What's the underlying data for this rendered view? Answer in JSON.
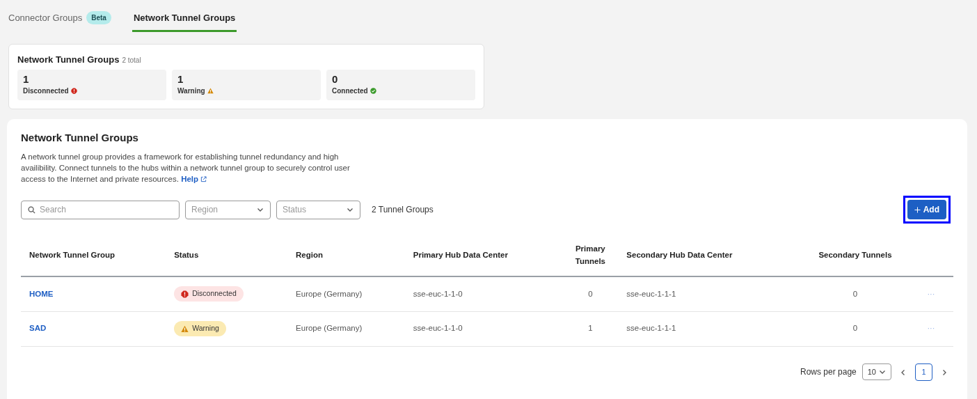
{
  "tabs": [
    {
      "label": "Connector Groups",
      "badge": "Beta",
      "selected": false
    },
    {
      "label": "Network Tunnel Groups",
      "selected": true
    }
  ],
  "summary": {
    "title": "Network Tunnel Groups",
    "total": "2 total",
    "stats": [
      {
        "count": "1",
        "label": "Disconnected",
        "kind": "disconnected"
      },
      {
        "count": "1",
        "label": "Warning",
        "kind": "warning"
      },
      {
        "count": "0",
        "label": "Connected",
        "kind": "connected"
      }
    ]
  },
  "panel": {
    "title": "Network Tunnel Groups",
    "description": "A network tunnel group provides a framework for establishing tunnel redundancy and high availibility. Connect tunnels to the hubs within a network tunnel group to securely control user access to the Internet and private resources.",
    "help_link": "Help",
    "search": {
      "placeholder": "Search"
    },
    "filters": [
      {
        "placeholder": "Region"
      },
      {
        "placeholder": "Status"
      }
    ],
    "result_count": "2 Tunnel Groups",
    "add_button": {
      "label": "Add",
      "highlighted": true
    }
  },
  "table": {
    "columns": [
      "Network Tunnel Group",
      "Status",
      "Region",
      "Primary Hub Data Center",
      "Primary Tunnels",
      "Secondary Hub Data Center",
      "Secondary Tunnels"
    ],
    "rows": [
      {
        "name": "HOME",
        "kind": "disconnected",
        "status_label": "Disconnected",
        "region": "Europe (Germany)",
        "primary_hub": "sse-euc-1-1-0",
        "primary_tunnels": "0",
        "secondary_hub": "sse-euc-1-1-1",
        "secondary_tunnels": "0",
        "menu": "···"
      },
      {
        "name": "SAD",
        "kind": "warning",
        "status_label": "Warning",
        "region": "Europe (Germany)",
        "primary_hub": "sse-euc-1-1-0",
        "primary_tunnels": "1",
        "secondary_hub": "sse-euc-1-1-1",
        "secondary_tunnels": "0",
        "menu": "···"
      }
    ]
  },
  "pagination": {
    "rows_label": "Rows per page",
    "page_size": "10",
    "pages": [
      {
        "label": "1",
        "selected": true
      }
    ]
  }
}
